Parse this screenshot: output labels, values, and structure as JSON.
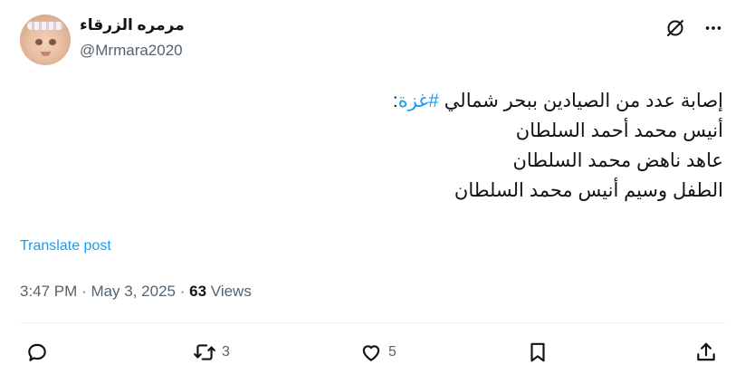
{
  "author": {
    "display_name": "مرمره الزرقاء",
    "handle": "@Mrmara2020"
  },
  "tweet": {
    "line1_prefix": "إصابة عدد من الصيادين ببحر شمالي ",
    "hashtag": "#غزة",
    "line1_suffix": ":",
    "body": "\nأنيس محمد أحمد السلطان\nعاهد ناهض محمد السلطان\nالطفل وسيم أنيس محمد السلطان"
  },
  "translate_label": "Translate post",
  "meta": {
    "time": "3:47 PM",
    "date": "May 3, 2025",
    "views_count": "63",
    "views_label": "Views"
  },
  "actions": {
    "retweets": "3",
    "likes": "5"
  },
  "icons": [
    "grok-icon",
    "more-icon",
    "reply-icon",
    "retweet-icon",
    "like-icon",
    "bookmark-icon",
    "share-icon"
  ],
  "colors": {
    "accent": "#1d9bf0",
    "text": "#0f1419",
    "secondary": "#536471"
  }
}
